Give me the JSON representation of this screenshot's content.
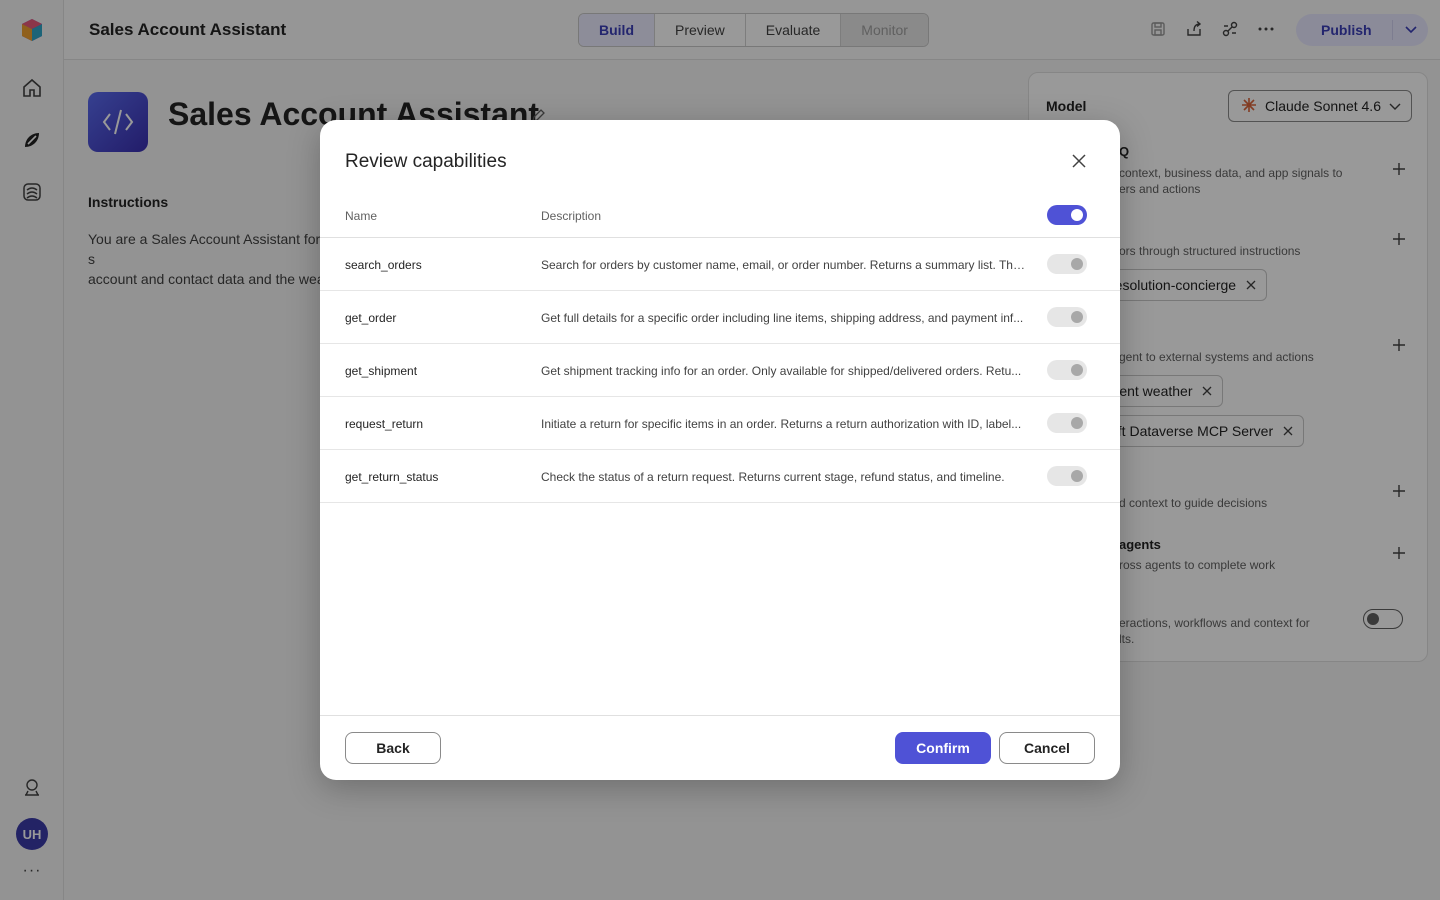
{
  "header": {
    "app_title": "Sales Account Assistant",
    "tabs": [
      {
        "label": "Build",
        "state": "active"
      },
      {
        "label": "Preview",
        "state": "normal"
      },
      {
        "label": "Evaluate",
        "state": "normal"
      },
      {
        "label": "Monitor",
        "state": "disabled"
      }
    ],
    "publish_label": "Publish",
    "icons": [
      "save-icon",
      "share-icon",
      "connect-icon",
      "more-icon"
    ]
  },
  "rail": {
    "avatar_initials": "UH",
    "more": "···"
  },
  "agent": {
    "name": "Sales Account Assistant",
    "instructions_label": "Instructions",
    "instructions_text": "You are a Sales Account Assistant for s\naccount and contact data and the wea\nin your knowledge. Complete the who"
  },
  "panel": {
    "model_label": "Model",
    "model_value": "Claude Sonnet 4.6",
    "knowledge_title": "Q",
    "knowledge_desc": "context, business data, and app signals to\ners and actions",
    "skills_desc": "ors through structured instructions",
    "skill_chip": "resolution-concierge",
    "tools_desc": "gent to external systems and actions",
    "tool_chip_1": "rrent weather",
    "tool_chip_2": "oft Dataverse MCP Server",
    "context_desc": "d context to guide decisions",
    "agents_title": "agents",
    "agents_desc": "ross agents to complete work",
    "memory_desc": "eractions, workflows and context for\nlts."
  },
  "dialog": {
    "title": "Review capabilities",
    "col_name": "Name",
    "col_description": "Description",
    "select_all": true,
    "rows": [
      {
        "name": "search_orders",
        "description": "Search for orders by customer name, email, or order number. Returns a summary list. This..."
      },
      {
        "name": "get_order",
        "description": "Get full details for a specific order including line items, shipping address, and payment inf..."
      },
      {
        "name": "get_shipment",
        "description": "Get shipment tracking info for an order. Only available for shipped/delivered orders. Retu..."
      },
      {
        "name": "request_return",
        "description": "Initiate a return for specific items in an order. Returns a return authorization with ID, label..."
      },
      {
        "name": "get_return_status",
        "description": "Check the status of a return request. Returns current stage, refund status, and timeline."
      }
    ],
    "back_label": "Back",
    "confirm_label": "Confirm",
    "cancel_label": "Cancel"
  },
  "colors": {
    "accent": "#4f52d6",
    "tab_active_text": "#3b3fb8"
  }
}
